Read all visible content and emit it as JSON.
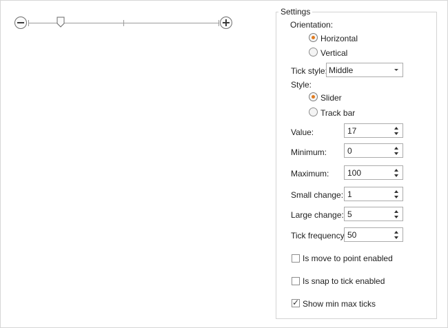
{
  "slider": {
    "minimum": 0,
    "maximum": 100,
    "value": 17,
    "tick_frequency": 50
  },
  "settings": {
    "title": "Settings",
    "orientation_label": "Orientation:",
    "orientation_options": [
      "Horizontal",
      "Vertical"
    ],
    "orientation_selected": "Horizontal",
    "tick_style_label": "Tick style:",
    "tick_style_value": "Middle",
    "style_label": "Style:",
    "style_options": [
      "Slider",
      "Track bar"
    ],
    "style_selected": "Slider",
    "fields": [
      {
        "label": "Value:",
        "value": "17"
      },
      {
        "label": "Minimum:",
        "value": "0"
      },
      {
        "label": "Maximum:",
        "value": "100"
      },
      {
        "label": "Small change:",
        "value": "1"
      },
      {
        "label": "Large change:",
        "value": "5"
      },
      {
        "label": "Tick frequency:",
        "value": "50"
      }
    ],
    "checkboxes": [
      {
        "label": "Is move to point enabled",
        "checked": false
      },
      {
        "label": "Is snap to tick enabled",
        "checked": false
      },
      {
        "label": "Show min max ticks",
        "checked": true
      }
    ]
  },
  "colors": {
    "radio_selected": "#e07a1f",
    "border": "#ababab"
  }
}
